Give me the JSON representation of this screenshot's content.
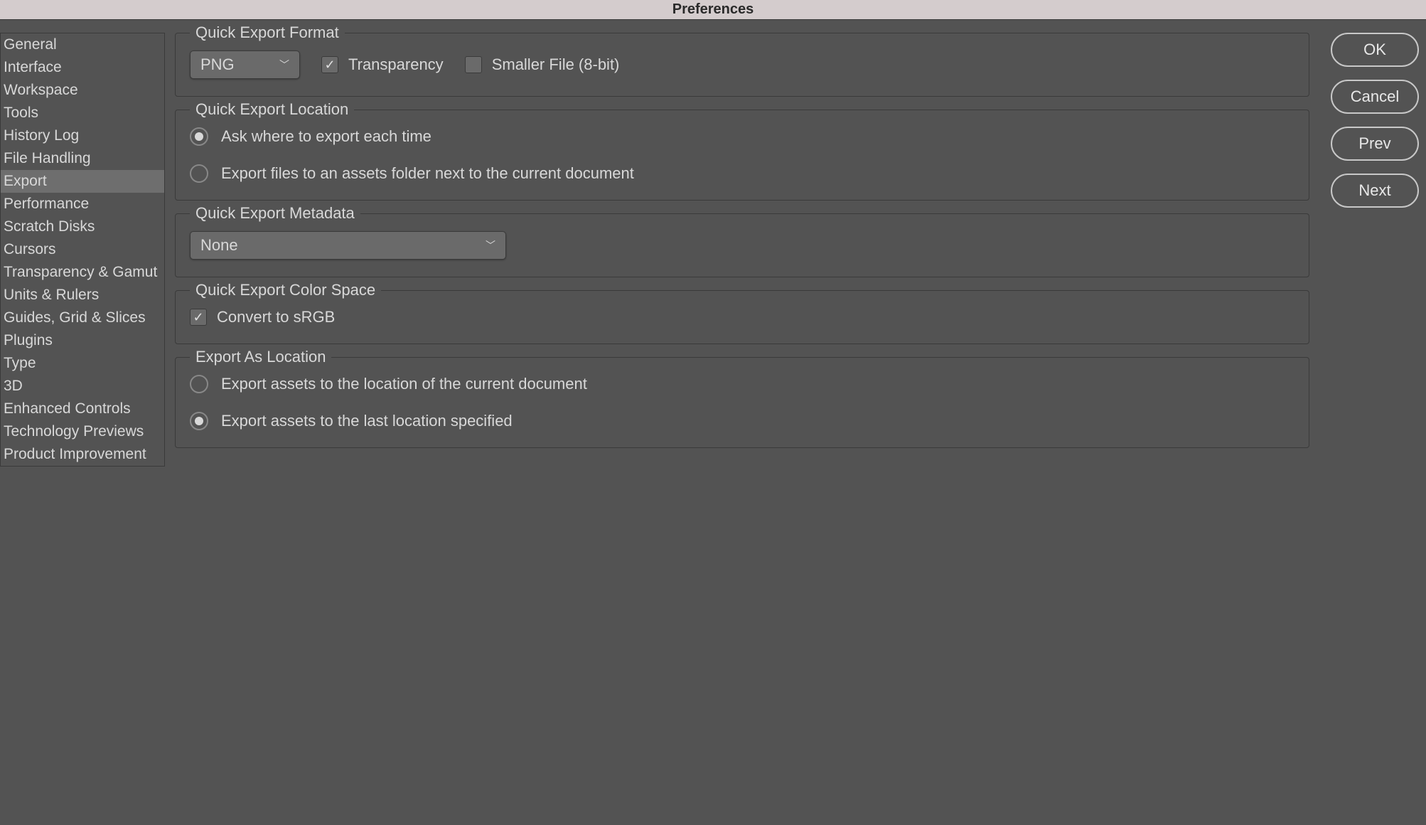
{
  "title": "Preferences",
  "sidebar": {
    "items": [
      {
        "label": "General"
      },
      {
        "label": "Interface"
      },
      {
        "label": "Workspace"
      },
      {
        "label": "Tools"
      },
      {
        "label": "History Log"
      },
      {
        "label": "File Handling"
      },
      {
        "label": "Export"
      },
      {
        "label": "Performance"
      },
      {
        "label": "Scratch Disks"
      },
      {
        "label": "Cursors"
      },
      {
        "label": "Transparency & Gamut"
      },
      {
        "label": "Units & Rulers"
      },
      {
        "label": "Guides, Grid & Slices"
      },
      {
        "label": "Plugins"
      },
      {
        "label": "Type"
      },
      {
        "label": "3D"
      },
      {
        "label": "Enhanced Controls"
      },
      {
        "label": "Technology Previews"
      },
      {
        "label": "Product Improvement"
      }
    ],
    "activeIndex": 6
  },
  "sections": {
    "format": {
      "legend": "Quick Export Format",
      "select_value": "PNG",
      "transparency_label": "Transparency",
      "smaller_file_label": "Smaller File (8-bit)"
    },
    "location": {
      "legend": "Quick Export Location",
      "option1": "Ask where to export each time",
      "option2": "Export files to an assets folder next to the current document"
    },
    "metadata": {
      "legend": "Quick Export Metadata",
      "select_value": "None"
    },
    "colorspace": {
      "legend": "Quick Export Color Space",
      "convert_label": "Convert to sRGB"
    },
    "export_as": {
      "legend": "Export As Location",
      "option1": "Export assets to the location of the current document",
      "option2": "Export assets to the last location specified"
    }
  },
  "buttons": {
    "ok": "OK",
    "cancel": "Cancel",
    "prev": "Prev",
    "next": "Next"
  }
}
